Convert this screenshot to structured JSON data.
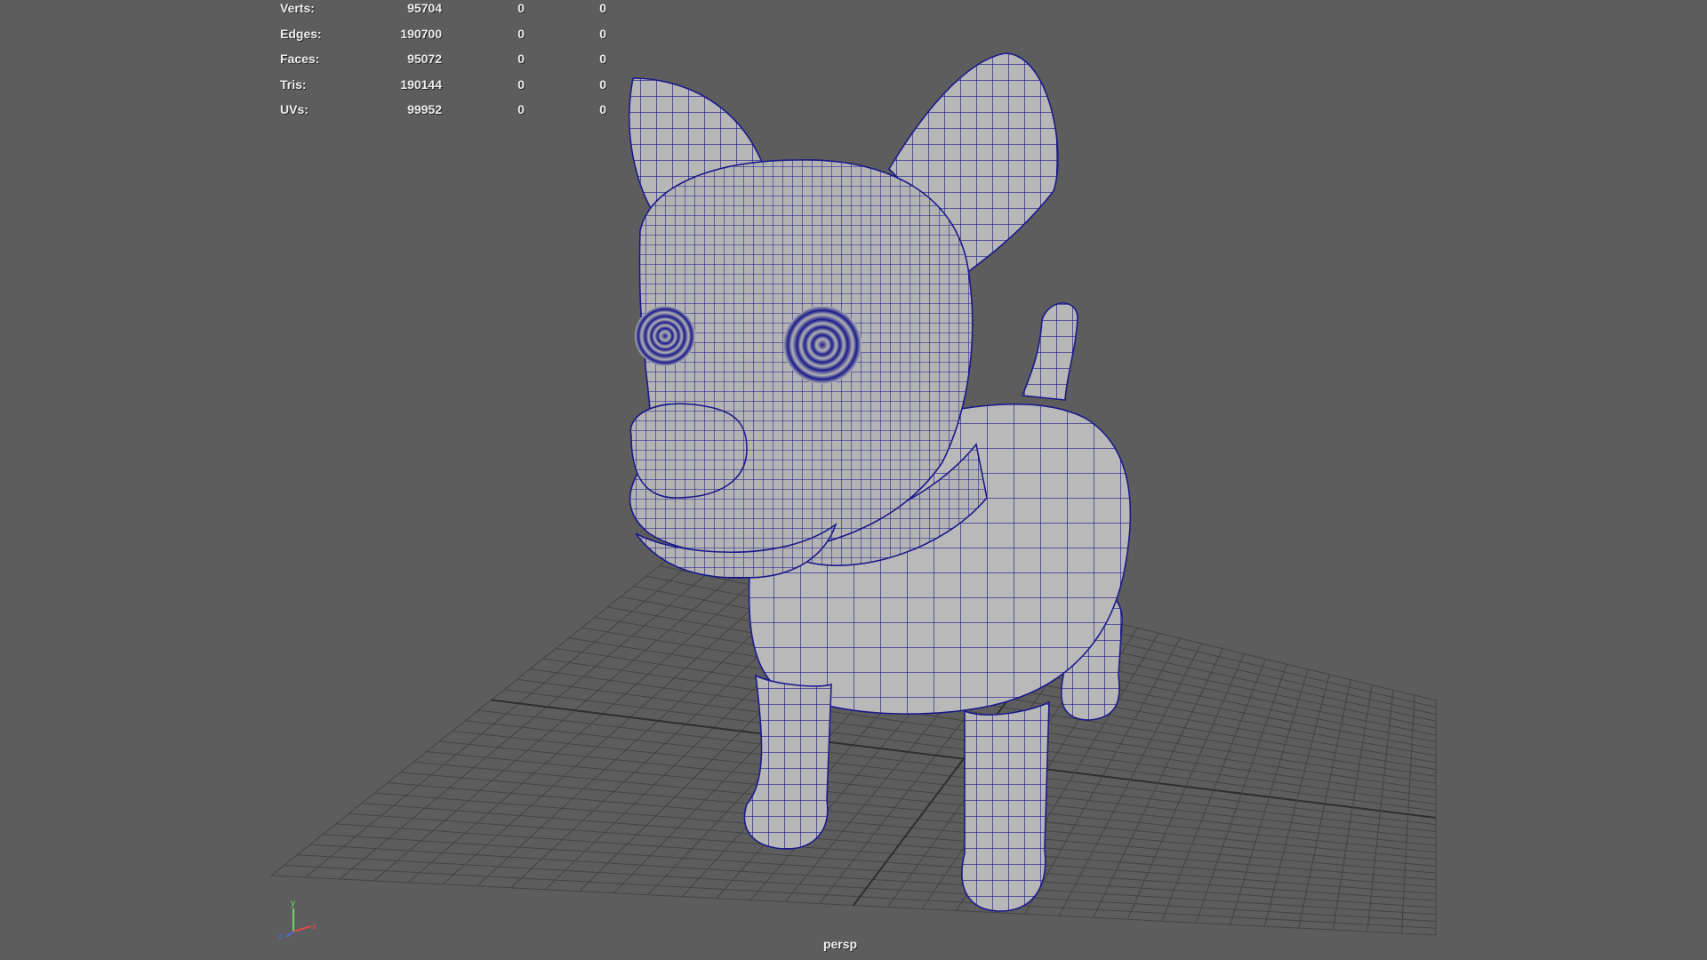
{
  "viewport": {
    "camera": "persp",
    "background": "#5d5d5d",
    "grid_color": "#3f3f3f",
    "wire_color": "#1a1a8c",
    "mesh_color": "#b4b4b4",
    "model": "dog"
  },
  "heads_up_display": {
    "rows": [
      {
        "label": "Verts:",
        "values": [
          "95704",
          "0",
          "0"
        ]
      },
      {
        "label": "Edges:",
        "values": [
          "190700",
          "0",
          "0"
        ]
      },
      {
        "label": "Faces:",
        "values": [
          "95072",
          "0",
          "0"
        ]
      },
      {
        "label": "Tris:",
        "values": [
          "190144",
          "0",
          "0"
        ]
      },
      {
        "label": "UVs:",
        "values": [
          "99952",
          "0",
          "0"
        ]
      }
    ]
  },
  "view_axis": {
    "x_label": "x",
    "y_label": "y",
    "z_label": "z"
  }
}
